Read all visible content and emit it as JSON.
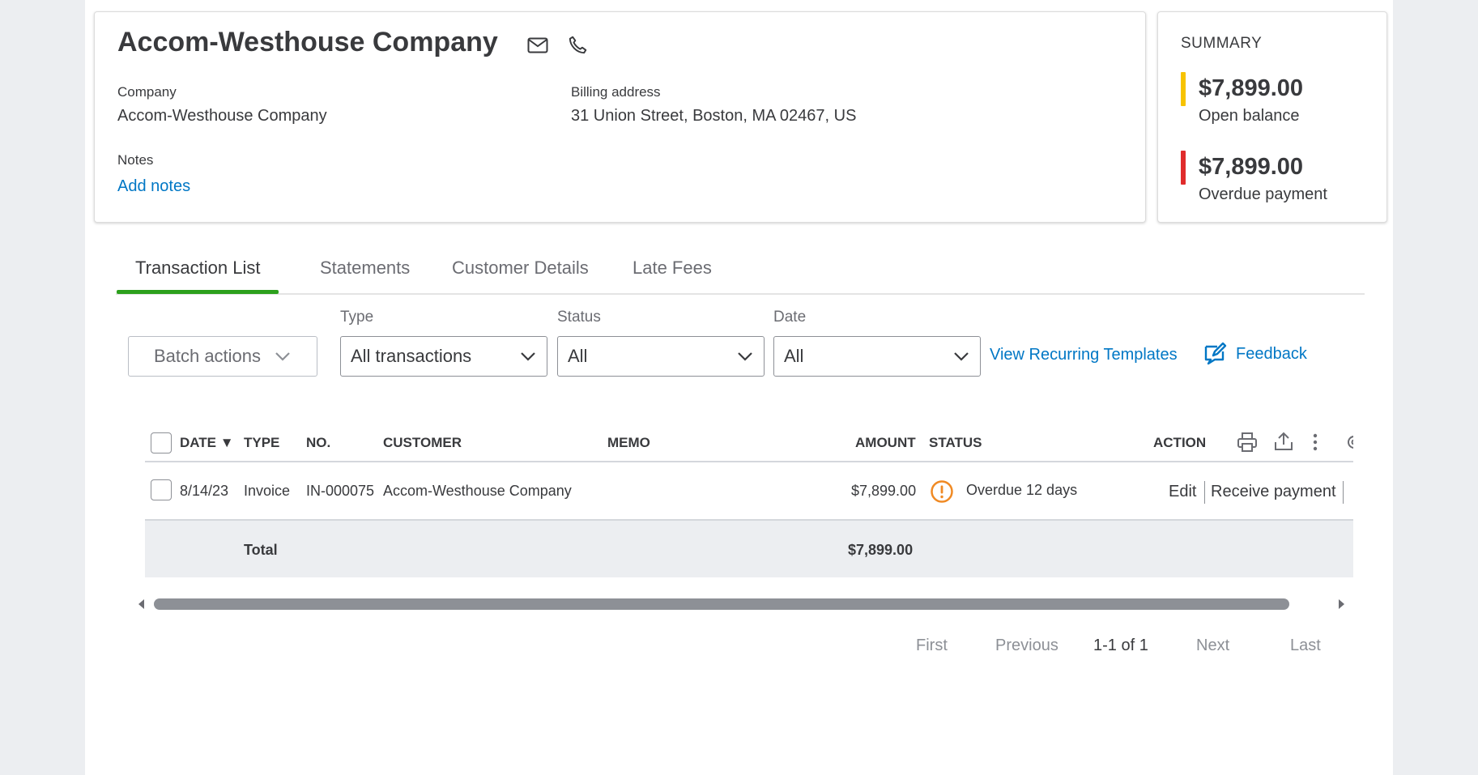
{
  "customer": {
    "name": "Accom-Westhouse Company",
    "company_label": "Company",
    "company_value": "Accom-Westhouse Company",
    "billing_label": "Billing address",
    "billing_value": "31 Union Street, Boston, MA 02467, US",
    "notes_label": "Notes",
    "add_notes": "Add notes",
    "icons": [
      "mail-icon",
      "phone-icon"
    ]
  },
  "summary": {
    "title": "SUMMARY",
    "open_amount": "$7,899.00",
    "open_label": "Open balance",
    "overdue_amount": "$7,899.00",
    "overdue_label": "Overdue payment",
    "colors": {
      "open": "#f7c300",
      "overdue": "#e02c2c"
    }
  },
  "tabs": [
    {
      "label": "Transaction List",
      "active": true
    },
    {
      "label": "Statements",
      "active": false
    },
    {
      "label": "Customer Details",
      "active": false
    },
    {
      "label": "Late Fees",
      "active": false
    }
  ],
  "filters": {
    "batch_actions": "Batch actions",
    "type_label": "Type",
    "type_value": "All transactions",
    "status_label": "Status",
    "status_value": "All",
    "date_label": "Date",
    "date_value": "All",
    "recurring_link": "View Recurring Templates",
    "feedback": "Feedback"
  },
  "table": {
    "headers": {
      "date": "DATE ▼",
      "type": "TYPE",
      "no": "NO.",
      "customer": "CUSTOMER",
      "memo": "MEMO",
      "amount": "AMOUNT",
      "status": "STATUS",
      "action": "ACTION"
    },
    "rows": [
      {
        "date": "8/14/23",
        "type": "Invoice",
        "no": "IN-000075",
        "customer": "Accom-Westhouse Company",
        "memo": "",
        "amount": "$7,899.00",
        "status": "Overdue 12 days",
        "actions": [
          "Edit",
          "Receive payment"
        ]
      }
    ],
    "total_label": "Total",
    "total_amount": "$7,899.00"
  },
  "pagination": {
    "first": "First",
    "previous": "Previous",
    "range": "1-1 of 1",
    "next": "Next",
    "last": "Last"
  },
  "colors": {
    "accent_green": "#2ca01c",
    "link_blue": "#0077c5",
    "warning_orange": "#f08a24"
  }
}
